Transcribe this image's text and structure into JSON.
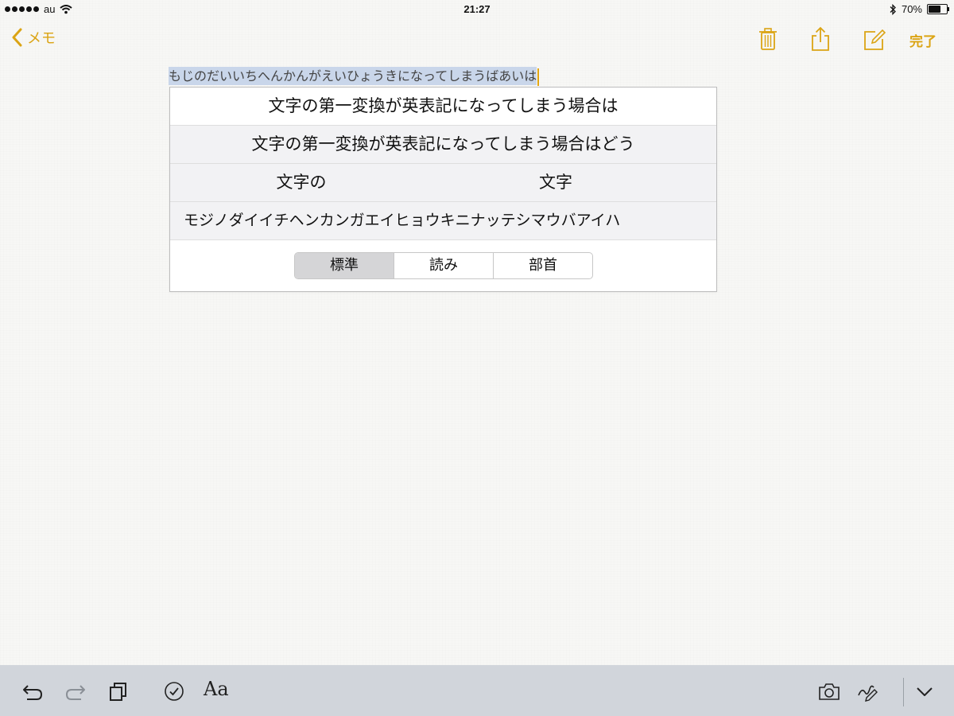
{
  "status_bar": {
    "carrier": "au",
    "time": "21:27",
    "battery_percent": "70%",
    "battery_level": 0.7
  },
  "nav": {
    "back_label": "メモ",
    "done_label": "完了",
    "icons": [
      "chevron-left-icon",
      "trash-icon",
      "share-icon",
      "compose-icon"
    ]
  },
  "note": {
    "text": "もじのだいいちへんかんがえいひょうきになってしまうばあいは"
  },
  "candidates": {
    "row1": "文字の第一変換が英表記になってしまう場合は",
    "row2": "文字の第一変換が英表記になってしまう場合はどう",
    "row3": [
      "文字の",
      "文字"
    ],
    "row4": "モジノダイイチヘンカンガエイヒョウキニナッテシマウバアイハ",
    "segments": [
      "標準",
      "読み",
      "部首"
    ],
    "selected_segment": "標準"
  },
  "toolbar": {
    "format_label": "Aa",
    "icons": [
      "undo-icon",
      "redo-icon",
      "copy-icon",
      "checklist-icon",
      "camera-icon",
      "sketch-icon",
      "chevron-down-icon"
    ]
  },
  "colors": {
    "accent": "#dba414",
    "marked_text_bg": "#c9d6ea",
    "toolbar_bg": "#d1d5db"
  }
}
